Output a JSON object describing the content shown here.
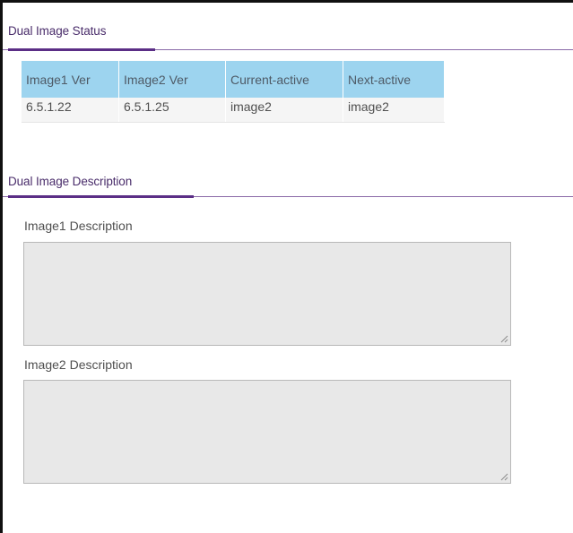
{
  "status_section": {
    "title": "Dual Image Status",
    "table": {
      "headers": [
        "Image1 Ver",
        "Image2 Ver",
        "Current-active",
        "Next-active"
      ],
      "rows": [
        [
          "6.5.1.22",
          "6.5.1.25",
          "image2",
          "image2"
        ]
      ]
    }
  },
  "description_section": {
    "title": "Dual Image Description",
    "image1": {
      "label": "Image1 Description",
      "value": ""
    },
    "image2": {
      "label": "Image2 Description",
      "value": ""
    }
  },
  "colors": {
    "accent_purple": "#5b2e86",
    "table_header_bg": "#9dd4ef",
    "textarea_bg": "#e8e8e8"
  },
  "icons": {
    "resize_grip": "resize-grip-icon"
  }
}
